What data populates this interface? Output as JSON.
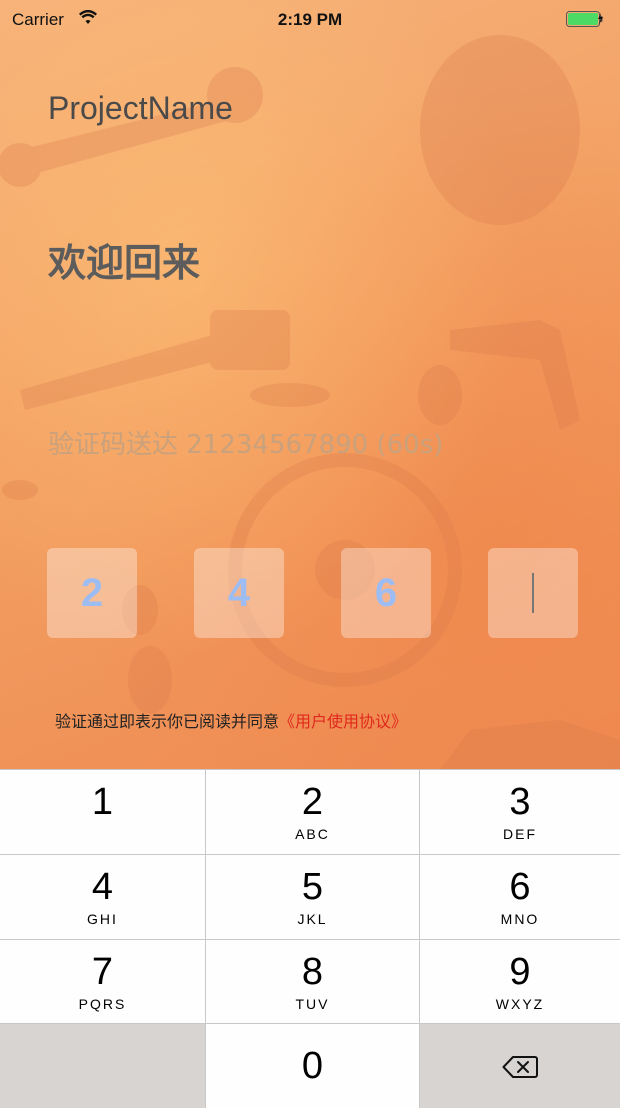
{
  "status_bar": {
    "carrier": "Carrier",
    "time": "2:19 PM",
    "wifi_icon": "wifi-icon",
    "battery_icon": "battery-charging-icon",
    "battery_color": "#4cd964"
  },
  "header": {
    "app_title": "ProjectName",
    "welcome": "欢迎回来"
  },
  "verification": {
    "sent_text": "验证码送达 21234567890 (60s)",
    "digits": [
      "2",
      "4",
      "6",
      ""
    ],
    "digit_color": "#9dbdf2"
  },
  "agreement": {
    "prefix": "验证通过即表示你已阅读并同意",
    "link": "《用户使用协议》",
    "link_color": "#e0281c"
  },
  "keypad": {
    "keys": [
      {
        "digit": "1",
        "letters": ""
      },
      {
        "digit": "2",
        "letters": "ABC"
      },
      {
        "digit": "3",
        "letters": "DEF"
      },
      {
        "digit": "4",
        "letters": "GHI"
      },
      {
        "digit": "5",
        "letters": "JKL"
      },
      {
        "digit": "6",
        "letters": "MNO"
      },
      {
        "digit": "7",
        "letters": "PQRS"
      },
      {
        "digit": "8",
        "letters": "TUV"
      },
      {
        "digit": "9",
        "letters": "WXYZ"
      },
      {
        "digit": "0",
        "letters": ""
      }
    ],
    "delete_icon": "backspace-icon"
  }
}
